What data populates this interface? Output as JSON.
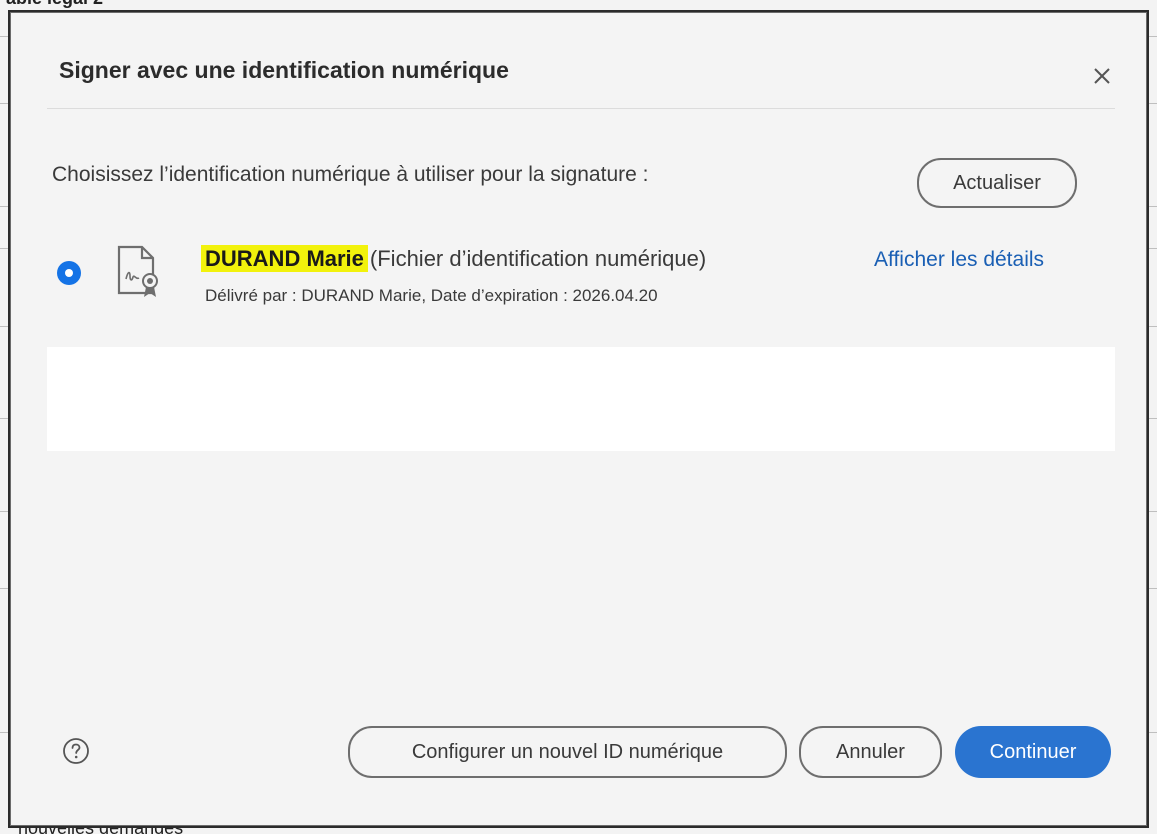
{
  "background": {
    "top_text": "able légal 2",
    "bottom_text": "nouvelles demandes"
  },
  "dialog": {
    "title": "Signer avec une identification numérique",
    "close_label": "×",
    "prompt": "Choisissez l’identification numérique à utiliser pour la signature :",
    "refresh_label": "Actualiser",
    "identity": {
      "name": "DURAND Marie",
      "type": "(Fichier d’identification numérique)",
      "issued": "Délivré par : DURAND Marie, Date d’expiration : 2026.04.20",
      "selected": true
    },
    "details_link": "Afficher les détails",
    "footer": {
      "configure_label": "Configurer un nouvel ID numérique",
      "cancel_label": "Annuler",
      "continue_label": "Continuer"
    }
  },
  "colors": {
    "accent": "#2a74d0",
    "link": "#1a5fb4",
    "highlight": "#f2f20c",
    "dialog_bg": "#f4f4f4"
  },
  "icons": [
    "close-icon",
    "certificate-icon",
    "help-icon",
    "radio-selected-icon"
  ]
}
